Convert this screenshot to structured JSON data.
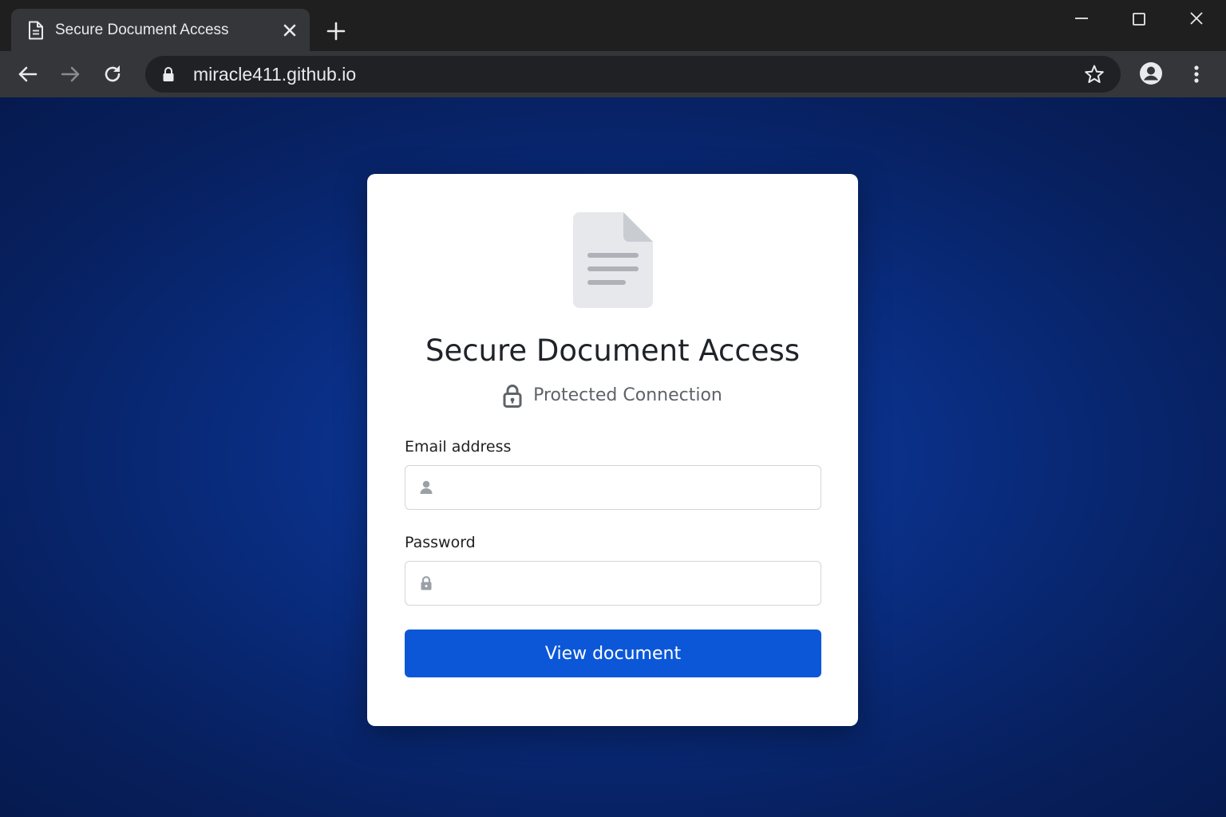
{
  "browser": {
    "tab": {
      "title": "Secure Document Access"
    },
    "address_bar": {
      "url": "miracle411.github.io"
    }
  },
  "card": {
    "title": "Secure Document Access",
    "subtitle": "Protected Connection",
    "email": {
      "label": "Email address",
      "value": "",
      "placeholder": ""
    },
    "password": {
      "label": "Password",
      "value": "",
      "placeholder": ""
    },
    "submit_label": "View document"
  },
  "icons": [
    "document-icon",
    "close-icon",
    "plus-icon",
    "minimize-icon",
    "maximize-icon",
    "window-close-icon",
    "back-arrow-icon",
    "forward-arrow-icon",
    "reload-icon",
    "lock-icon",
    "star-icon",
    "account-icon",
    "kebab-menu-icon",
    "user-icon"
  ],
  "colors": {
    "background": "#0a2f86",
    "primary_button": "#0b57d8",
    "card": "#ffffff",
    "chrome_dark": "#1f1f1f",
    "chrome_toolbar": "#35363a"
  }
}
